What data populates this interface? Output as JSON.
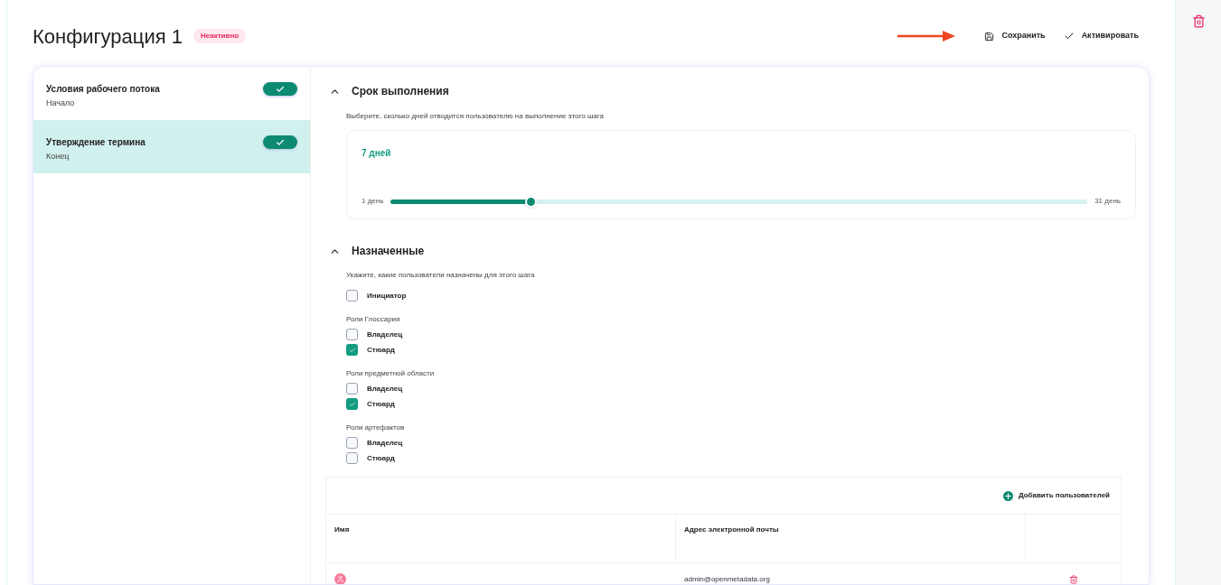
{
  "header": {
    "title": "Конфигурация 1",
    "status": "Неактивно",
    "actions": [
      {
        "kind": "save",
        "label": "Сохранить"
      },
      {
        "kind": "activate",
        "label": "Активировать"
      }
    ]
  },
  "steps": [
    {
      "title": "Условия рабочего потока",
      "subtitle": "Начало",
      "selected": false,
      "on": true
    },
    {
      "title": "Утверждение термина",
      "subtitle": "Конец",
      "selected": true,
      "on": true
    }
  ],
  "deadline": {
    "title": "Срок выполнения",
    "expanded": true,
    "description": "Выберите, сколько дней отводится пользователю на выполнение этого шага",
    "value": "7 дней",
    "min_label": "1 день",
    "max_label": "31 день",
    "level": 0.2
  },
  "assignees": {
    "title": "Назначенные",
    "expanded": true,
    "description": "Укажите, какие пользователи назначены для этого шага",
    "groups": [
      {
        "options": [
          {
            "label": "Инициатор",
            "checked": false
          }
        ]
      },
      {
        "title": "Роли Глоссария",
        "options": [
          {
            "label": "Владелец",
            "checked": false
          },
          {
            "label": "Стюард",
            "checked": true
          }
        ]
      },
      {
        "title": "Роли предметной области",
        "options": [
          {
            "label": "Владелец",
            "checked": false
          },
          {
            "label": "Стюард",
            "checked": true
          }
        ]
      },
      {
        "title": "Роли артефактов",
        "options": [
          {
            "label": "Владелец",
            "checked": false
          },
          {
            "label": "Стюард",
            "checked": false
          }
        ]
      }
    ]
  },
  "users_table": {
    "add_button": "Добавить пользователей",
    "columns": [
      "Имя",
      "Адрес электронной почты"
    ],
    "rows": [
      {
        "email": "admin@openmetadata.org"
      }
    ]
  }
}
